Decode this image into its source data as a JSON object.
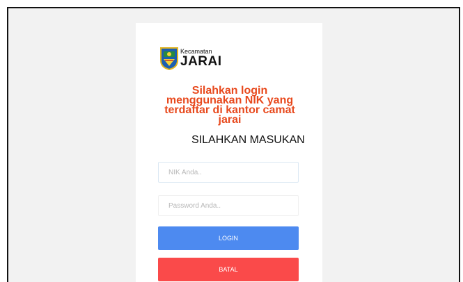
{
  "logo": {
    "small": "Kecamatan",
    "big": "JARAI",
    "emblem_icon": "regency-crest-icon"
  },
  "notice": "Silahkan login menggunakan NIK yang terdaftar di kantor camat jarai",
  "heading": "SILAHKAN MASUKAN",
  "form": {
    "nik_placeholder": "NIK Anda..",
    "password_placeholder": "Password Anda..",
    "nik_value": "",
    "password_value": ""
  },
  "buttons": {
    "login": "LOGIN",
    "cancel": "BATAL"
  },
  "colors": {
    "notice": "#e8491d",
    "login": "#4d8af0",
    "cancel": "#fa4a4a",
    "background": "#f2f2f2"
  }
}
